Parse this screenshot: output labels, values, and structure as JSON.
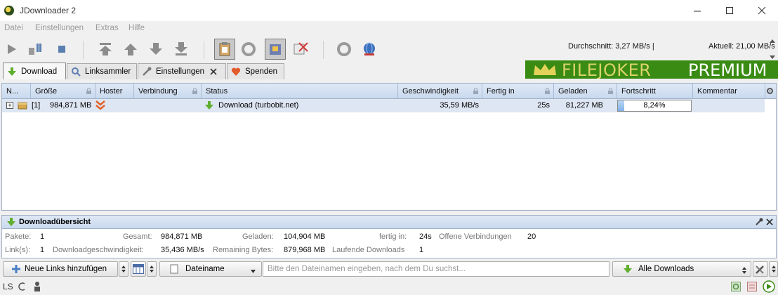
{
  "window": {
    "title": "JDownloader 2"
  },
  "menu": [
    "Datei",
    "Einstellungen",
    "Extras",
    "Hilfe"
  ],
  "toolbar": {
    "avg_speed": "Durchschnitt: 3,27 MB/s |",
    "current_speed": "Aktuell: 21,00 MB/s"
  },
  "tabs": [
    {
      "label": "Download"
    },
    {
      "label": "Linksammler"
    },
    {
      "label": "Einstellungen"
    },
    {
      "label": "Spenden"
    }
  ],
  "banner": {
    "text1": "FILEJOKER",
    "text2": "PREMIUM"
  },
  "table": {
    "columns": [
      "N...",
      "Größe",
      "Hoster",
      "Verbindung",
      "Status",
      "Geschwindigkeit",
      "Fertig in",
      "Geladen",
      "Fortschritt",
      "Kommentar"
    ],
    "rows": [
      {
        "expand": "+",
        "name": "[1]",
        "size": "984,871 MB",
        "status": "Download (turbobit.net)",
        "speed": "35,59 MB/s",
        "eta": "25s",
        "loaded": "81,227 MB",
        "progress_text": "8,24%",
        "progress": 0.0824
      }
    ]
  },
  "overview": {
    "title": "Downloadübersicht",
    "row1": {
      "pakete_label": "Pakete:",
      "pakete": "1",
      "gesamt_label": "Gesamt:",
      "gesamt": "984,871 MB",
      "geladen_label": "Geladen:",
      "geladen": "104,904 MB",
      "fertig_label": "fertig in:",
      "fertig": "24s",
      "offene_label": "Offene Verbindungen",
      "offene": "20"
    },
    "row2": {
      "links_label": "Link(s):",
      "links": "1",
      "speed_label": "Downloadgeschwindigkeit:",
      "speed": "35,436 MB/s",
      "remaining_label": "Remaining Bytes:",
      "remaining": "879,968 MB",
      "laufende_label": "Laufende Downloads",
      "laufende": "1"
    }
  },
  "bottom": {
    "add_links": "Neue Links hinzufügen",
    "search_field": "Dateiname",
    "search_placeholder": "Bitte den Dateinamen eingeben, nach dem Du suchst...",
    "filter": "Alle Downloads"
  },
  "statusbar": {
    "ls": "LS"
  },
  "colors": {
    "accent": "#3a8b13",
    "header": "#c9d9ee",
    "row": "#dde6f2"
  }
}
